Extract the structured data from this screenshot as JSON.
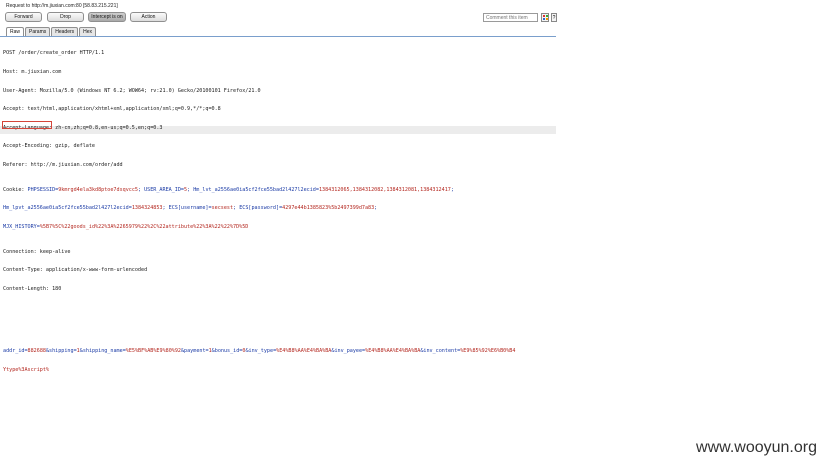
{
  "window": {
    "title": "Request to http://m.jiuxian.com:80  [58.83.215.221]"
  },
  "toolbar": {
    "forward": "Forward",
    "drop": "Drop",
    "intercept": "Intercept is on",
    "action": "Action",
    "comment_placeholder": "Comment this item",
    "more": "?"
  },
  "tabs": [
    {
      "label": "Raw",
      "active": true
    },
    {
      "label": "Params",
      "active": false
    },
    {
      "label": "Headers",
      "active": false
    },
    {
      "label": "Hex",
      "active": false
    }
  ],
  "request": {
    "request_line": "POST /order/create_order HTTP/1.1",
    "host": "Host: m.jiuxian.com",
    "user_agent": "User-Agent: Mozilla/5.0 (Windows NT 6.2; WOW64; rv:21.0) Gecko/20100101 Firefox/21.0",
    "accept": "Accept: text/html,application/xhtml+xml,application/xml;q=0.9,*/*;q=0.8",
    "accept_language": "Accept-Language: zh-cn,zh;q=0.8,en-us;q=0.5,en;q=0.3",
    "accept_encoding": "Accept-Encoding: gzip, deflate",
    "referer": "Referer: http://m.jiuxian.com/order/add",
    "cookie": {
      "label": "Cookie: ",
      "seg1_name": "PHPSESSID",
      "seg1_eq": "=",
      "seg1_value": "9kmrgd4ela3kd8ptoe7dsqvcc5",
      "seg2_name": "; USER_AREA_ID",
      "seg2_eq": "=",
      "seg2_value": "5",
      "seg3_name": "; Hm_lvt_a2556ae0ia5cf2fce55bad2l427l2ecid",
      "seg3_eq": "=",
      "seg3_value": "1384312065,1384312082,1384312081,1384312417",
      "seg3_cont": ";",
      "seg4_name": "Hm_lpvt_a2556ae0ia5cf2fce55bad2l427l2ecid",
      "seg4_eq": "=",
      "seg4_value": "1384324853",
      "seg5_name": "; ECS[username]",
      "seg5_eq": "=",
      "seg5_value": "secsest",
      "seg6_name": "; ECS[password]",
      "seg6_eq": "=",
      "seg6_value": "4297e44b1385823%5b2497399d7a83",
      "seg6_cont": ";",
      "seg7_name": "MJX_HISTORY",
      "seg7_eq": "=",
      "seg7_value": "%5B7%5C%22goods_id%22%3A%2265979%22%2C%22attribute%22%3A%22%22%7D%5D"
    },
    "connection": "Connection: keep-alive",
    "content_type": "Content-Type: application/x-www-form-urlencoded",
    "content_length": "Content-Length: 180",
    "body": {
      "p1_name": "addr_id",
      "p1_eq": "=",
      "p1_value": "882688",
      "amp1": "&",
      "p2_name": "shipping",
      "p2_eq": "=",
      "p2_value": "1",
      "amp2": "&",
      "p3_name": "shipping_name",
      "p3_eq": "=",
      "p3_value": "%E5%BF%AB%E9%80%92",
      "amp3": "&",
      "p4_name": "payment",
      "p4_eq": "=",
      "p4_value": "1",
      "amp4": "&",
      "p5_name": "bonus_id",
      "p5_eq": "=",
      "p5_value": "0",
      "amp5": "&",
      "p6_name": "inv_type",
      "p6_eq": "=",
      "p6_value": "%E4%B8%AA%E4%BA%BA",
      "amp6": "&",
      "p7_name": "inv_payee",
      "p7_eq": "=",
      "p7_value": "%E4%B8%AA%E4%BA%BA",
      "amp7": "&",
      "p8_name": "inv_content",
      "p8_eq": "=",
      "p8_value": "%E9%85%92%E6%B0%B4",
      "p8_cont": "Ytype%3Ascript%",
      "tail": ""
    }
  },
  "watermark": "www.wooyun.org",
  "colors": {
    "param_name": "#1a3aa5",
    "param_value": "#b3261e",
    "selection_border": "#d4453a",
    "tab_rule": "#7a9fcc"
  }
}
